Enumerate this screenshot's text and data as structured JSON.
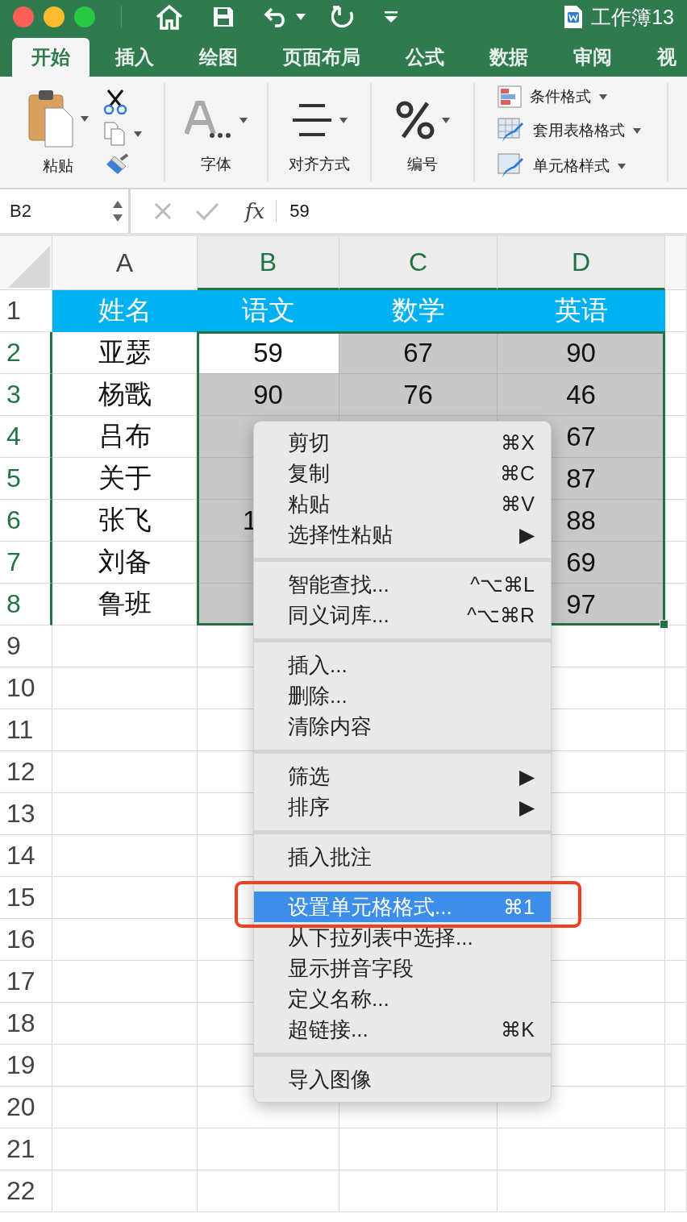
{
  "title_bar": {
    "document_title": "工作簿13"
  },
  "tabs": [
    {
      "label": "开始",
      "selected": true
    },
    {
      "label": "插入",
      "selected": false
    },
    {
      "label": "绘图",
      "selected": false
    },
    {
      "label": "页面布局",
      "selected": false
    },
    {
      "label": "公式",
      "selected": false
    },
    {
      "label": "数据",
      "selected": false
    },
    {
      "label": "审阅",
      "selected": false
    },
    {
      "label": "视",
      "selected": false
    }
  ],
  "ribbon": {
    "paste_label": "粘贴",
    "groups": [
      {
        "label": "字体",
        "kind": "font"
      },
      {
        "label": "对齐方式",
        "kind": "align"
      },
      {
        "label": "编号",
        "kind": "number"
      }
    ],
    "styles": [
      {
        "label": "条件格式",
        "kind": "conditional"
      },
      {
        "label": "套用表格格式",
        "kind": "table"
      },
      {
        "label": "单元格样式",
        "kind": "cell"
      }
    ]
  },
  "formula_bar": {
    "name_box": "B2",
    "function_label": "fx",
    "value": "59"
  },
  "columns": [
    {
      "label": "A",
      "selected": false
    },
    {
      "label": "B",
      "selected": true
    },
    {
      "label": "C",
      "selected": true
    },
    {
      "label": "D",
      "selected": true
    }
  ],
  "rows": [
    {
      "number": "1",
      "selected": false,
      "cells": [
        {
          "text": "姓名",
          "kind": "header",
          "selected": false
        },
        {
          "text": "语文",
          "kind": "header",
          "selected": false
        },
        {
          "text": "数学",
          "kind": "header",
          "selected": false
        },
        {
          "text": "英语",
          "kind": "header",
          "selected": false
        }
      ]
    },
    {
      "number": "2",
      "selected": true,
      "cells": [
        {
          "text": "亚瑟",
          "kind": "data",
          "selected": false
        },
        {
          "text": "59",
          "kind": "data",
          "selected": true,
          "active": true
        },
        {
          "text": "67",
          "kind": "data",
          "selected": true
        },
        {
          "text": "90",
          "kind": "data",
          "selected": true
        }
      ]
    },
    {
      "number": "3",
      "selected": true,
      "cells": [
        {
          "text": "杨戬",
          "kind": "data",
          "selected": false
        },
        {
          "text": "90",
          "kind": "data",
          "selected": true
        },
        {
          "text": "76",
          "kind": "data",
          "selected": true
        },
        {
          "text": "46",
          "kind": "data",
          "selected": true
        }
      ]
    },
    {
      "number": "4",
      "selected": true,
      "cells": [
        {
          "text": "吕布",
          "kind": "data",
          "selected": false
        },
        {
          "kind": "data",
          "selected": true
        },
        null,
        {
          "text": "67",
          "kind": "data",
          "selected": true
        }
      ]
    },
    {
      "number": "5",
      "selected": true,
      "cells": [
        {
          "text": "关于",
          "kind": "data",
          "selected": false
        },
        {
          "kind": "data",
          "selected": true
        },
        null,
        {
          "text": "87",
          "kind": "data",
          "selected": true
        }
      ]
    },
    {
      "number": "6",
      "selected": true,
      "cells": [
        {
          "text": "张飞",
          "kind": "data",
          "selected": false
        },
        {
          "text": "1",
          "kind": "partial",
          "selected": true
        },
        null,
        {
          "text": "88",
          "kind": "data",
          "selected": true
        }
      ]
    },
    {
      "number": "7",
      "selected": true,
      "cells": [
        {
          "text": "刘备",
          "kind": "data",
          "selected": false
        },
        {
          "kind": "data",
          "selected": true
        },
        null,
        {
          "text": "69",
          "kind": "data",
          "selected": true
        }
      ]
    },
    {
      "number": "8",
      "selected": true,
      "cells": [
        {
          "text": "鲁班",
          "kind": "data",
          "selected": false
        },
        {
          "kind": "data",
          "selected": true
        },
        null,
        {
          "text": "97",
          "kind": "data",
          "selected": true
        }
      ]
    },
    {
      "number": "9",
      "selected": false
    },
    {
      "number": "10",
      "selected": false
    },
    {
      "number": "11",
      "selected": false
    },
    {
      "number": "12",
      "selected": false
    },
    {
      "number": "13",
      "selected": false
    },
    {
      "number": "14",
      "selected": false
    },
    {
      "number": "15",
      "selected": false
    },
    {
      "number": "16",
      "selected": false
    },
    {
      "number": "17",
      "selected": false
    },
    {
      "number": "18",
      "selected": false
    },
    {
      "number": "19",
      "selected": false
    },
    {
      "number": "20",
      "selected": false
    },
    {
      "number": "21",
      "selected": false
    },
    {
      "number": "22",
      "selected": false
    }
  ],
  "context_menu": {
    "groups": [
      {
        "items": [
          {
            "label": "剪切",
            "shortcut": "⌘X",
            "selected": false,
            "outlined": false
          },
          {
            "label": "复制",
            "shortcut": "⌘C",
            "selected": false,
            "outlined": false
          },
          {
            "label": "粘贴",
            "shortcut": "⌘V",
            "selected": false,
            "outlined": false
          },
          {
            "label": "选择性粘贴",
            "shortcut": "▶",
            "selected": false,
            "outlined": false
          }
        ]
      },
      {
        "items": [
          {
            "label": "智能查找...",
            "shortcut": "^⌥⌘L",
            "selected": false,
            "outlined": false
          },
          {
            "label": "同义词库...",
            "shortcut": "^⌥⌘R",
            "selected": false,
            "outlined": false
          }
        ]
      },
      {
        "items": [
          {
            "label": "插入...",
            "selected": false,
            "outlined": false
          },
          {
            "label": "删除...",
            "selected": false,
            "outlined": false
          },
          {
            "label": "清除内容",
            "selected": false,
            "outlined": false
          }
        ]
      },
      {
        "items": [
          {
            "label": "筛选",
            "shortcut": "▶",
            "selected": false,
            "outlined": false
          },
          {
            "label": "排序",
            "shortcut": "▶",
            "selected": false,
            "outlined": false
          }
        ]
      },
      {
        "items": [
          {
            "label": "插入批注",
            "selected": false,
            "outlined": false
          }
        ]
      },
      {
        "items": [
          {
            "label": "设置单元格格式...",
            "shortcut": "⌘1",
            "selected": true,
            "outlined": true
          },
          {
            "label": "从下拉列表中选择...",
            "selected": false,
            "outlined": false
          },
          {
            "label": "显示拼音字段",
            "selected": false,
            "outlined": false
          },
          {
            "label": "定义名称...",
            "selected": false,
            "outlined": false
          },
          {
            "label": "超链接...",
            "shortcut": "⌘K",
            "selected": false,
            "outlined": false
          }
        ]
      },
      {
        "items": [
          {
            "label": "导入图像",
            "selected": false,
            "outlined": false
          }
        ]
      }
    ]
  }
}
